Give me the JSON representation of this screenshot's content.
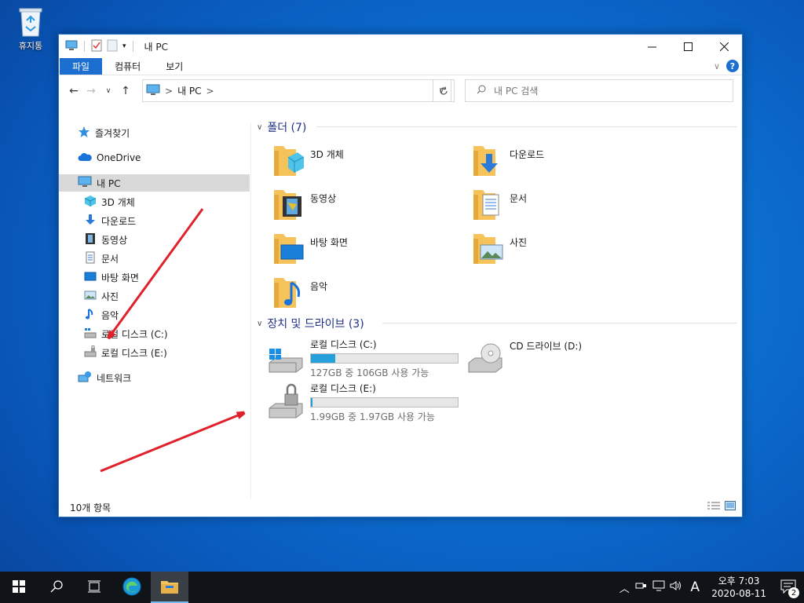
{
  "desktop": {
    "recycle_bin": "휴지통"
  },
  "window": {
    "title": "내 PC",
    "ribbon_tabs": [
      "파일",
      "컴퓨터",
      "보기"
    ],
    "help_label": "?",
    "address": {
      "crumb": "내 PC",
      "separator": ">"
    },
    "search_placeholder": "내 PC 검색",
    "status": "10개 항목"
  },
  "sidebar": {
    "items": [
      {
        "label": "즐겨찾기",
        "icon": "star-icon"
      },
      {
        "label": "OneDrive",
        "icon": "cloud-icon"
      },
      {
        "label": "내 PC",
        "icon": "pc-icon"
      },
      {
        "label": "3D 개체",
        "icon": "cube-icon"
      },
      {
        "label": "다운로드",
        "icon": "download-icon"
      },
      {
        "label": "동영상",
        "icon": "video-icon"
      },
      {
        "label": "문서",
        "icon": "document-icon"
      },
      {
        "label": "바탕 화면",
        "icon": "desktop-icon"
      },
      {
        "label": "사진",
        "icon": "picture-icon"
      },
      {
        "label": "음악",
        "icon": "music-icon"
      },
      {
        "label": "로컬 디스크 (C:)",
        "icon": "drive-icon"
      },
      {
        "label": "로컬 디스크 (E:)",
        "icon": "locked-drive-icon"
      },
      {
        "label": "네트워크",
        "icon": "network-icon"
      }
    ]
  },
  "content": {
    "folders_header": "폴더 (7)",
    "folders": [
      {
        "label": "3D 개체",
        "icon": "cube-icon"
      },
      {
        "label": "다운로드",
        "icon": "download-icon"
      },
      {
        "label": "동영상",
        "icon": "video-icon"
      },
      {
        "label": "문서",
        "icon": "document-icon"
      },
      {
        "label": "바탕 화면",
        "icon": "desktop-icon"
      },
      {
        "label": "사진",
        "icon": "picture-icon"
      },
      {
        "label": "음악",
        "icon": "music-icon"
      }
    ],
    "devices_header": "장치 및 드라이브 (3)",
    "drives": [
      {
        "label": "로컬 디스크 (C:)",
        "free": "127GB 중 106GB 사용 가능",
        "used_fraction": 0.165
      },
      {
        "label": "CD 드라이브 (D:)"
      },
      {
        "label": "로컬 디스크 (E:)",
        "free": "1.99GB 중 1.97GB 사용 가능",
        "used_fraction": 0.01
      }
    ]
  },
  "taskbar": {
    "clock_time": "오후 7:03",
    "clock_date": "2020-08-11",
    "ime": "A",
    "notification_count": "2"
  },
  "colors": {
    "accent": "#1c6fd0",
    "drive_fill": "#26a0da",
    "arrow": "#e0202a",
    "folder": "#f5c35a"
  }
}
